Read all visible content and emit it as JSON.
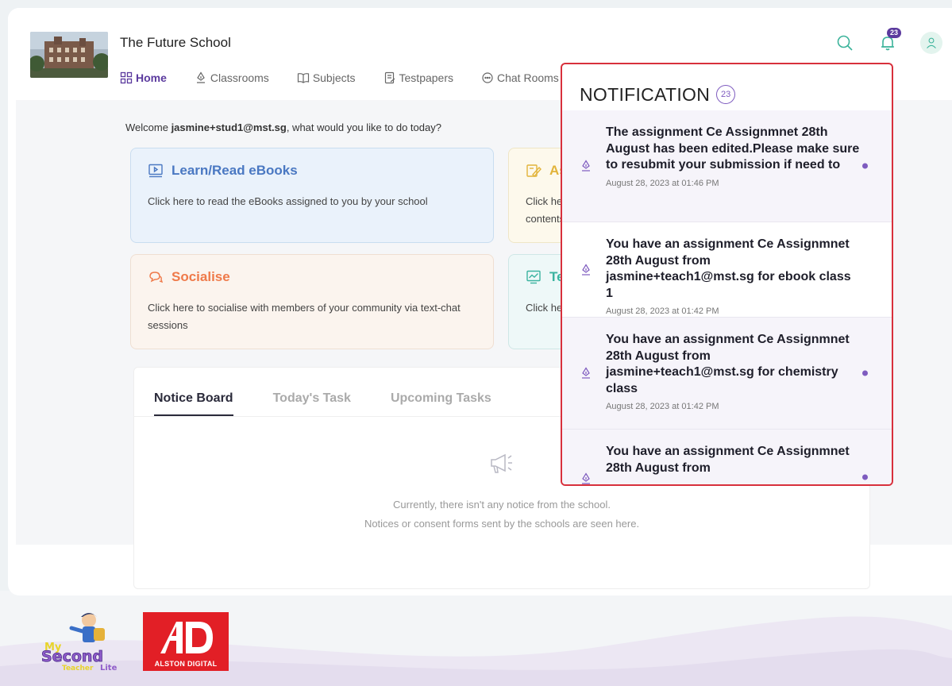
{
  "school": {
    "name": "The Future School"
  },
  "nav": [
    {
      "label": "Home",
      "icon": "grid-icon",
      "active": true
    },
    {
      "label": "Classrooms",
      "icon": "pen-nib-icon"
    },
    {
      "label": "Subjects",
      "icon": "book-icon"
    },
    {
      "label": "Testpapers",
      "icon": "document-icon"
    },
    {
      "label": "Chat Rooms",
      "icon": "chat-bubble-icon"
    }
  ],
  "header": {
    "notification_badge": "23"
  },
  "welcome": {
    "prefix": "Welcome ",
    "user": "jasmine+stud1@mst.sg",
    "suffix": ", what would you like to do today?"
  },
  "tiles": {
    "learn": {
      "title": "Learn/Read eBooks",
      "desc": "Click here to read the eBooks assigned to you by your school",
      "color": "#4a78c2"
    },
    "assign": {
      "title": "Ass",
      "desc_line1": "Click he",
      "desc_line2": "contents",
      "color": "#e2b43a"
    },
    "social": {
      "title": "Socialise",
      "desc": "Click here to socialise with members of your community via text-chat sessions",
      "color": "#ef7a4a"
    },
    "tests": {
      "title": "Tes",
      "desc": "Click he",
      "color": "#3bb3a0"
    }
  },
  "board": {
    "tabs": [
      "Notice Board",
      "Today's Task",
      "Upcoming Tasks"
    ],
    "empty_line1": "Currently, there isn't any notice from the school.",
    "empty_line2": "Notices or consent forms sent by the schools are seen here."
  },
  "notifications": {
    "title": "NOTIFICATION",
    "count": "23",
    "items": [
      {
        "message": "The assignment Ce Assignmnet 28th August has been edited.Please make sure to resubmit your submission if need to",
        "time": "August 28, 2023 at 01:46 PM",
        "unread": true
      },
      {
        "message": "You have an assignment Ce Assignmnet 28th August from jasmine+teach1@mst.sg for ebook class 1",
        "time": "August 28, 2023 at 01:42 PM",
        "unread": false
      },
      {
        "message": "You have an assignment Ce Assignmnet 28th August from jasmine+teach1@mst.sg for chemistry class",
        "time": "August 28, 2023 at 01:42 PM",
        "unread": true
      },
      {
        "message": "You have an assignment Ce Assignmnet 28th August from",
        "time": "",
        "unread": true
      }
    ]
  },
  "footer": {
    "mst_logo_text": "My Second Teacher Lite",
    "ad_logo_text": "ALSTON DIGITAL"
  },
  "colors": {
    "brand": "#5b3a9e",
    "accent": "#7e5bbf",
    "highlight": "#d8303c"
  }
}
